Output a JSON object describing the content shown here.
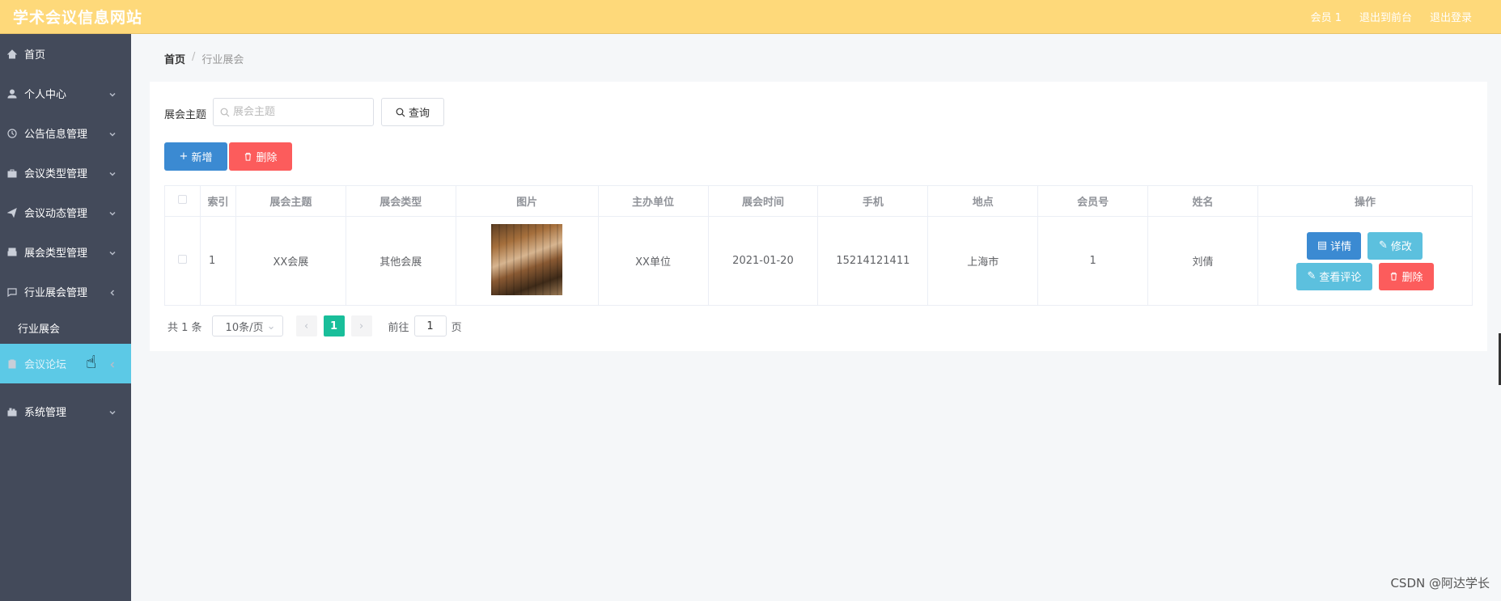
{
  "header": {
    "title": "学术会议信息网站",
    "links": [
      "会员 1",
      "退出到前台",
      "退出登录"
    ],
    "bg_color": "#fed97a"
  },
  "sidebar": {
    "items": [
      {
        "label": "首页",
        "icon": "home-icon"
      },
      {
        "label": "个人中心",
        "icon": "user-icon"
      },
      {
        "label": "公告信息管理",
        "icon": "clock-icon"
      },
      {
        "label": "会议类型管理",
        "icon": "briefcase-icon"
      },
      {
        "label": "会议动态管理",
        "icon": "send-icon"
      },
      {
        "label": "展会类型管理",
        "icon": "printer-icon"
      },
      {
        "label": "行业展会管理",
        "icon": "message-icon"
      },
      {
        "label": "会议论坛",
        "icon": "clipboard-icon"
      },
      {
        "label": "系统管理",
        "icon": "settings-icon"
      }
    ],
    "submenu": [
      "行业展会"
    ],
    "bg_color": "#434a5a",
    "active_color": "#5cc9e6"
  },
  "breadcrumb": {
    "home": "首页",
    "separator": "/",
    "current": "行业展会"
  },
  "search": {
    "label": "展会主题",
    "placeholder": "展会主题",
    "query_label": "查询"
  },
  "actions": {
    "add_label": "新增",
    "delete_label": "删除"
  },
  "table": {
    "headers": [
      "索引",
      "展会主题",
      "展会类型",
      "图片",
      "主办单位",
      "展会时间",
      "手机",
      "地点",
      "会员号",
      "姓名",
      "操作"
    ],
    "rows": [
      {
        "index": "1",
        "theme": "XX会展",
        "type": "其他会展",
        "organizer": "XX单位",
        "date": "2021-01-20",
        "phone": "15214121411",
        "location": "上海市",
        "member_no": "1",
        "name": "刘倩"
      }
    ],
    "ops": {
      "detail": "详情",
      "edit": "修改",
      "comment": "查看评论",
      "delete": "删除"
    }
  },
  "pagination": {
    "total": "共 1 条",
    "page_size": "10条/页",
    "current_page": "1",
    "goto_label": "前往",
    "goto_value": "1",
    "page_suffix": "页"
  },
  "watermark": "CSDN @阿达学长"
}
